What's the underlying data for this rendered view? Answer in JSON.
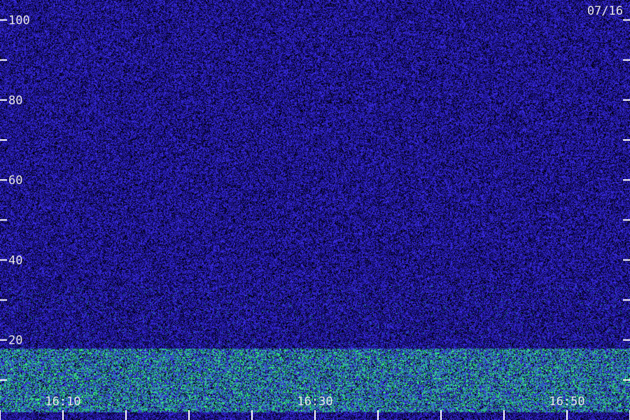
{
  "date_label": "07/16",
  "colors": {
    "background": "#140c78",
    "noise": "#3a2ce0",
    "dark": "#000000",
    "band_mid": "#1a9a9a",
    "band_high": "#40ff70",
    "tick": "#ffffff",
    "label": "#e8e8e8"
  },
  "chart_data": {
    "type": "heatmap",
    "title": "",
    "xlabel": "",
    "ylabel": "",
    "x_range": [
      "16:05",
      "16:55"
    ],
    "y_range": [
      0,
      105
    ],
    "y_tick_labels": [
      {
        "value": 20,
        "label": "20"
      },
      {
        "value": 40,
        "label": "40"
      },
      {
        "value": 60,
        "label": "60"
      },
      {
        "value": 80,
        "label": "80"
      },
      {
        "value": 100,
        "label": "100"
      }
    ],
    "y_minor_ticks": [
      10,
      30,
      50,
      70,
      90
    ],
    "x_tick_labels": [
      {
        "value": "16:10",
        "label": "16:10"
      },
      {
        "value": "16:30",
        "label": "16:30"
      },
      {
        "value": "16:50",
        "label": "16:50"
      }
    ],
    "x_ticks": [
      "16:05",
      "16:10",
      "16:15",
      "16:20",
      "16:25",
      "16:30",
      "16:35",
      "16:40",
      "16:45",
      "16:50",
      "16:55"
    ],
    "bright_band": [
      2,
      18
    ]
  }
}
